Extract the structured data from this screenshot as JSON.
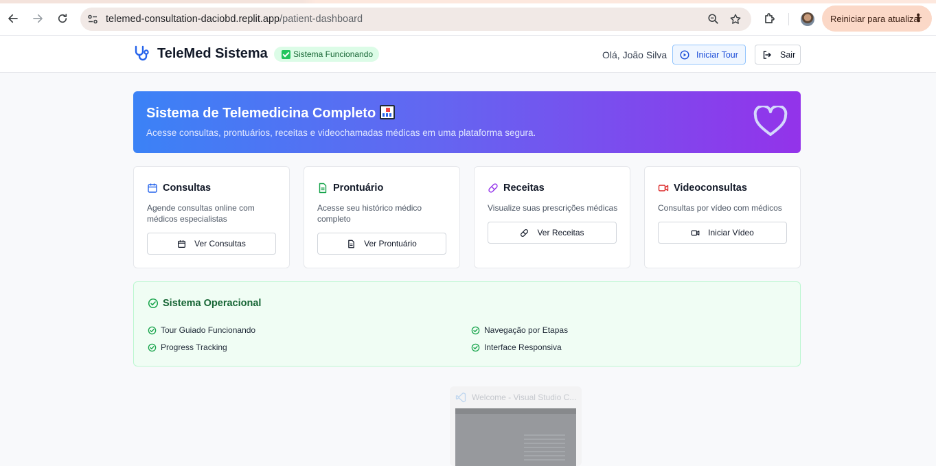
{
  "browser": {
    "url_host": "telemed-consultation-daciobd.replit.app",
    "url_path": "/patient-dashboard",
    "update_button_label": "Reiniciar para atualizar",
    "icons": [
      "back-arrow-icon",
      "forward-arrow-icon",
      "reload-icon",
      "site-info-icon",
      "zoom-icon",
      "star-icon",
      "extensions-icon",
      "kebab-menu-icon"
    ]
  },
  "header": {
    "app_title": "TeleMed Sistema",
    "status_label": "Sistema Funcionando",
    "greeting": "Olá, João Silva",
    "tour_button": "Iniciar Tour",
    "logout_button": "Sair"
  },
  "hero": {
    "title": "Sistema de Telemedicina Completo",
    "subtitle": "Acesse consultas, prontuários, receitas e videochamadas médicas em uma plataforma segura."
  },
  "cards": [
    {
      "title": "Consultas",
      "description": "Agende consultas online com médicos especialistas",
      "button": "Ver Consultas",
      "icon": "calendar-icon",
      "icon_color": "#2563eb"
    },
    {
      "title": "Prontuário",
      "description": "Acesse seu histórico médico completo",
      "button": "Ver Prontuário",
      "icon": "document-icon",
      "icon_color": "#16a34a"
    },
    {
      "title": "Receitas",
      "description": "Visualize suas prescrições médicas",
      "button": "Ver Receitas",
      "icon": "pill-icon",
      "icon_color": "#9333ea"
    },
    {
      "title": "Videoconsultas",
      "description": "Consultas por vídeo com médicos",
      "button": "Iniciar Vídeo",
      "icon": "video-icon",
      "icon_color": "#dc2626"
    }
  ],
  "operational": {
    "title": "Sistema Operacional",
    "items": [
      "Tour Guiado Funcionando",
      "Navegação por Etapas",
      "Progress Tracking",
      "Interface Responsiva"
    ]
  },
  "thumbnail": {
    "title": "Welcome - Visual Studio C..."
  },
  "colors": {
    "primary": "#2563eb",
    "success": "#16a34a",
    "hero_gradient_start": "#3b82f6",
    "hero_gradient_end": "#9333ea"
  }
}
